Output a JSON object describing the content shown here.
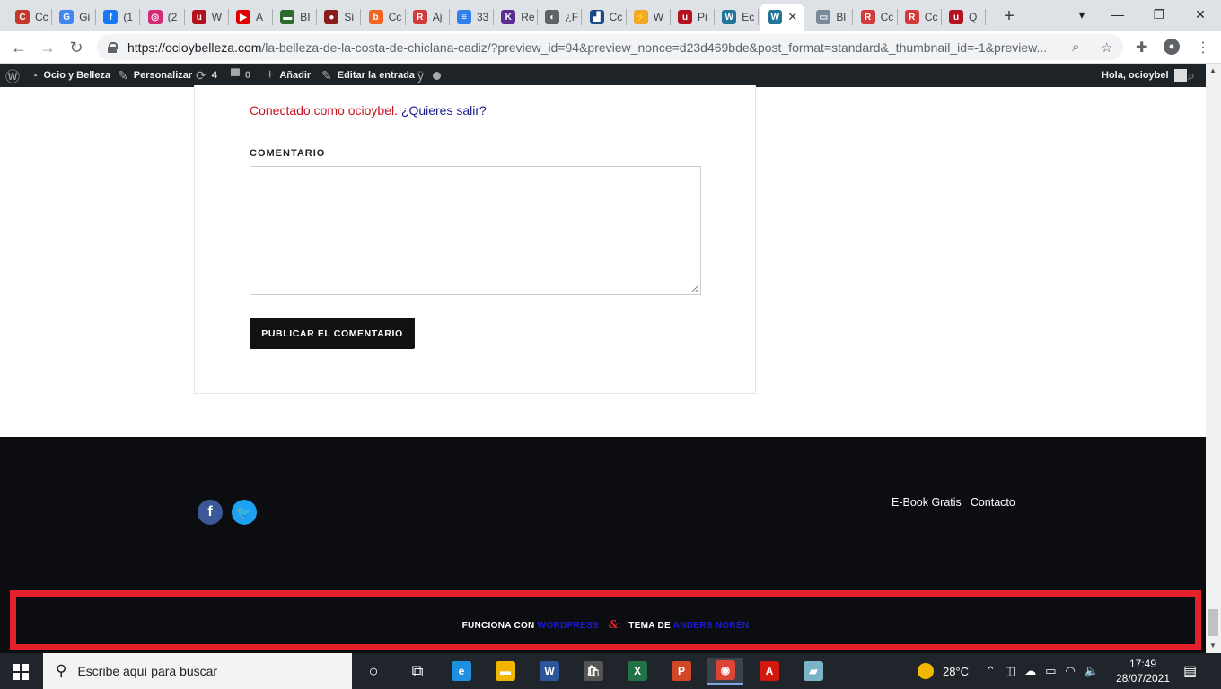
{
  "browser": {
    "tabs": [
      {
        "title": "Cc",
        "color": "#c0392b",
        "glyph": "C"
      },
      {
        "title": "Gi",
        "color": "#4285f4",
        "glyph": "G"
      },
      {
        "title": "(1",
        "color": "#1877f2",
        "glyph": "f"
      },
      {
        "title": "(2",
        "color": "#d62976",
        "glyph": "◎"
      },
      {
        "title": "W",
        "color": "#b3121f",
        "glyph": "u"
      },
      {
        "title": "A",
        "color": "#e00000",
        "glyph": "▶"
      },
      {
        "title": "BI",
        "color": "#2d6b2d",
        "glyph": "▬"
      },
      {
        "title": "Si",
        "color": "#8b1a1a",
        "glyph": "●"
      },
      {
        "title": "Cc",
        "color": "#f26522",
        "glyph": "b"
      },
      {
        "title": "Aj",
        "color": "#d23b3b",
        "glyph": "R"
      },
      {
        "title": "33",
        "color": "#2f80ed",
        "glyph": "≡"
      },
      {
        "title": "Re",
        "color": "#5b2d8e",
        "glyph": "K"
      },
      {
        "title": "¿F",
        "color": "#5f6368",
        "glyph": "◐"
      },
      {
        "title": "Cc",
        "color": "#1a4a8a",
        "glyph": "▟"
      },
      {
        "title": "W",
        "color": "#f5a623",
        "glyph": "⚡"
      },
      {
        "title": "Pi",
        "color": "#b3121f",
        "glyph": "u"
      },
      {
        "title": "Ec",
        "color": "#21759b",
        "glyph": "W"
      }
    ],
    "active_tab": {
      "color": "#21759b",
      "glyph": "W",
      "close": "✕"
    },
    "tabs_after": [
      {
        "title": "Bl",
        "color": "#7a8a9a",
        "glyph": "▭"
      },
      {
        "title": "Cc",
        "color": "#d23b3b",
        "glyph": "R"
      },
      {
        "title": "Cc",
        "color": "#d23b3b",
        "glyph": "R"
      },
      {
        "title": "Q",
        "color": "#b3121f",
        "glyph": "u"
      }
    ],
    "new_tab": "+",
    "url_host": "https://ocioybelleza.com",
    "url_path": "/la-belleza-de-la-costa-de-chiclana-cadiz/?preview_id=94&preview_nonce=d23d469bde&post_format=standard&_thumbnail_id=-1&preview...",
    "window_controls": [
      "—",
      "❐",
      "✕"
    ]
  },
  "adminbar": {
    "site_name": "Ocio y Belleza",
    "customize": "Personalizar",
    "updates_count": "4",
    "comments_count": "0",
    "add_new": "Añadir",
    "edit_post": "Editar la entrada",
    "greeting": "Hola, ocioybel"
  },
  "comment_form": {
    "logged_in_text": "Conectado como ocioybel.",
    "logout_link": "¿Quieres salir?",
    "comment_label": "COMENTARIO",
    "submit_label": "PUBLICAR EL COMENTARIO"
  },
  "footer": {
    "links": [
      "E-Book Gratis",
      "Contacto"
    ],
    "credits_prefix": "FUNCIONA CON",
    "credits_wp": "WORDPRESS",
    "credits_amp": "&",
    "credits_theme_prefix": "TEMA DE",
    "credits_author": "ANDERS NORÉN"
  },
  "taskbar": {
    "search_placeholder": "Escribe aquí para buscar",
    "apps": [
      {
        "name": "task-view",
        "glyph": "○",
        "color": "transparent"
      },
      {
        "name": "timeline",
        "glyph": "⧉",
        "color": "transparent"
      },
      {
        "name": "edge",
        "glyph": "e",
        "color": "#1f8fe0"
      },
      {
        "name": "file-explorer",
        "glyph": "▬",
        "color": "#f2b600"
      },
      {
        "name": "word",
        "glyph": "W",
        "color": "#2b579a"
      },
      {
        "name": "store",
        "glyph": "🛍",
        "color": "#555"
      },
      {
        "name": "excel",
        "glyph": "X",
        "color": "#217346"
      },
      {
        "name": "powerpoint",
        "glyph": "P",
        "color": "#d24726"
      },
      {
        "name": "chrome",
        "glyph": "◉",
        "color": "#db4437"
      },
      {
        "name": "acrobat",
        "glyph": "A",
        "color": "#d4170f"
      },
      {
        "name": "notes",
        "glyph": "▰",
        "color": "#7bb3c9"
      }
    ],
    "weather": "28°C",
    "time": "17:49",
    "date": "28/07/2021"
  }
}
